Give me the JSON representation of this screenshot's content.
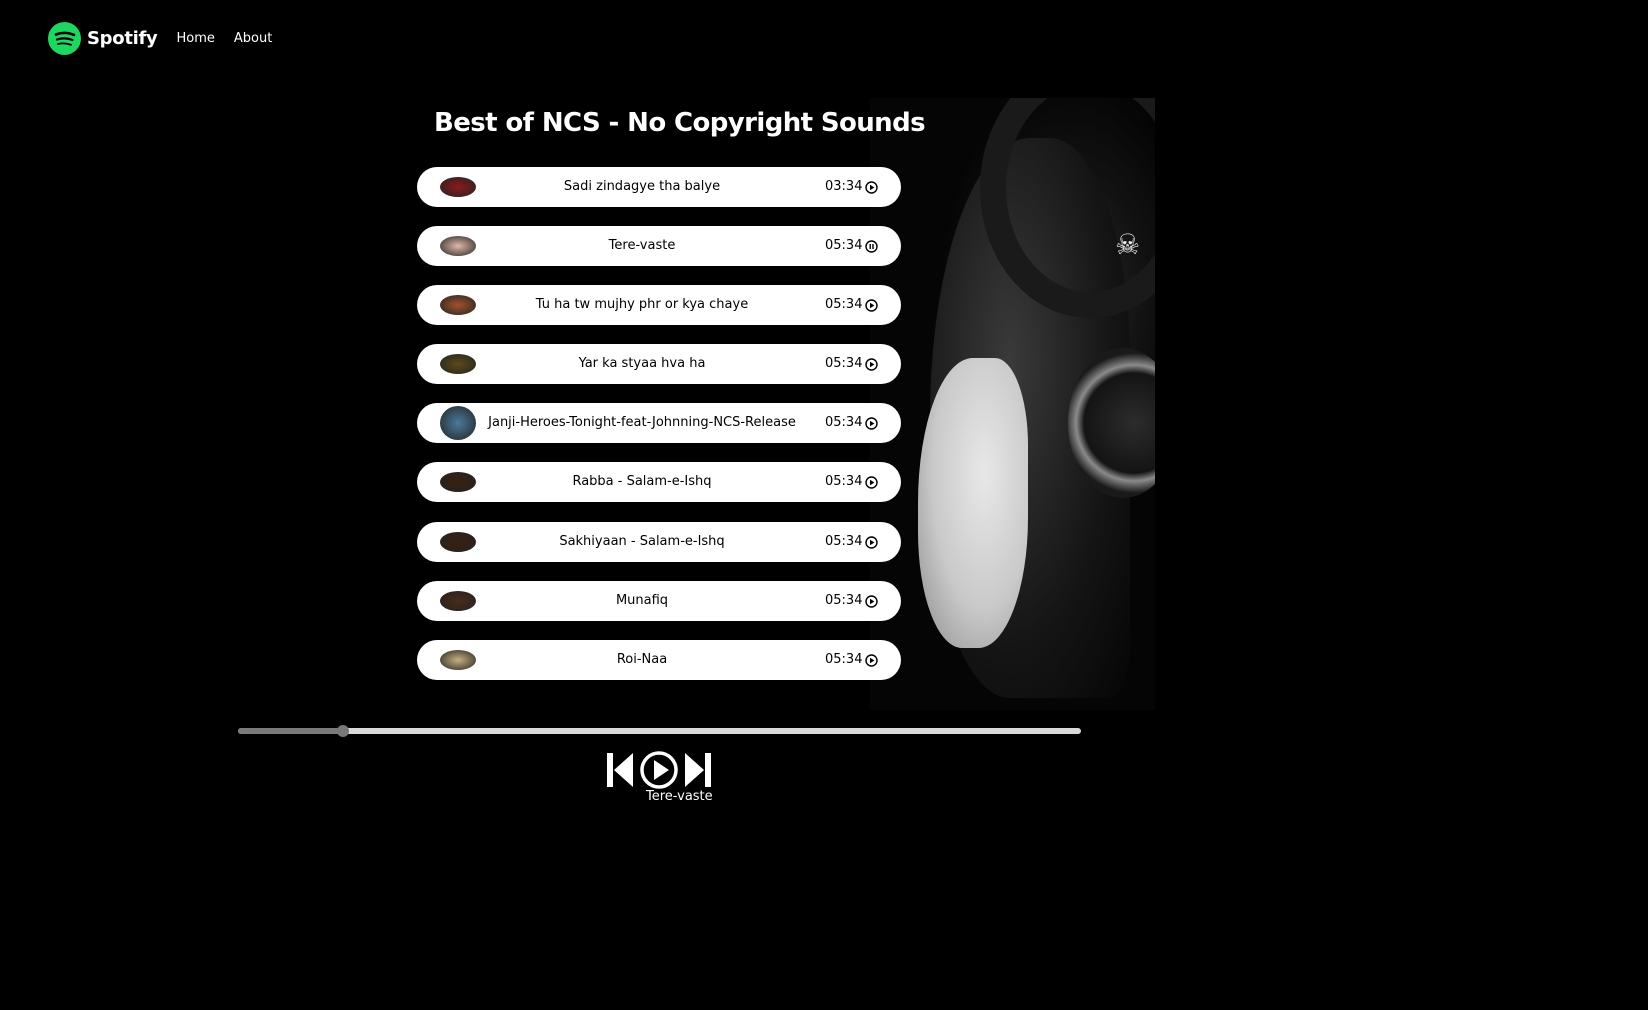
{
  "nav": {
    "brand": "Spotify",
    "brand_color": "#1ed760",
    "links": [
      "Home",
      "About"
    ]
  },
  "playlist": {
    "title": "Best of NCS - No Copyright Sounds",
    "songs": [
      {
        "name": "Sadi zindagye tha balye",
        "duration": "03:34",
        "state": "play",
        "thumb": "#8b1a1a"
      },
      {
        "name": "Tere-vaste",
        "duration": "05:34",
        "state": "pause",
        "thumb": "#e0b8a8"
      },
      {
        "name": "Tu ha tw mujhy phr or kya chaye",
        "duration": "05:34",
        "state": "play",
        "thumb": "#a0522d"
      },
      {
        "name": "Yar ka styaa hva ha",
        "duration": "05:34",
        "state": "play",
        "thumb": "#5a4a1a"
      },
      {
        "name": "Janji-Heroes-Tonight-feat-Johnning-NCS-Release",
        "duration": "05:34",
        "state": "play",
        "thumb": "#4a7a9a"
      },
      {
        "name": "Rabba - Salam-e-Ishq",
        "duration": "05:34",
        "state": "play",
        "thumb": "#3a2010"
      },
      {
        "name": "Sakhiyaan - Salam-e-Ishq",
        "duration": "05:34",
        "state": "play",
        "thumb": "#3a2010"
      },
      {
        "name": "Munafiq",
        "duration": "05:34",
        "state": "play",
        "thumb": "#4a2a1a"
      },
      {
        "name": "Roi-Naa",
        "duration": "05:34",
        "state": "play",
        "thumb": "#c8b080"
      }
    ]
  },
  "player": {
    "progress_fraction": 0.125,
    "now_playing": "Tere-vaste",
    "icons": [
      "previous-icon",
      "play-icon",
      "next-icon"
    ]
  }
}
